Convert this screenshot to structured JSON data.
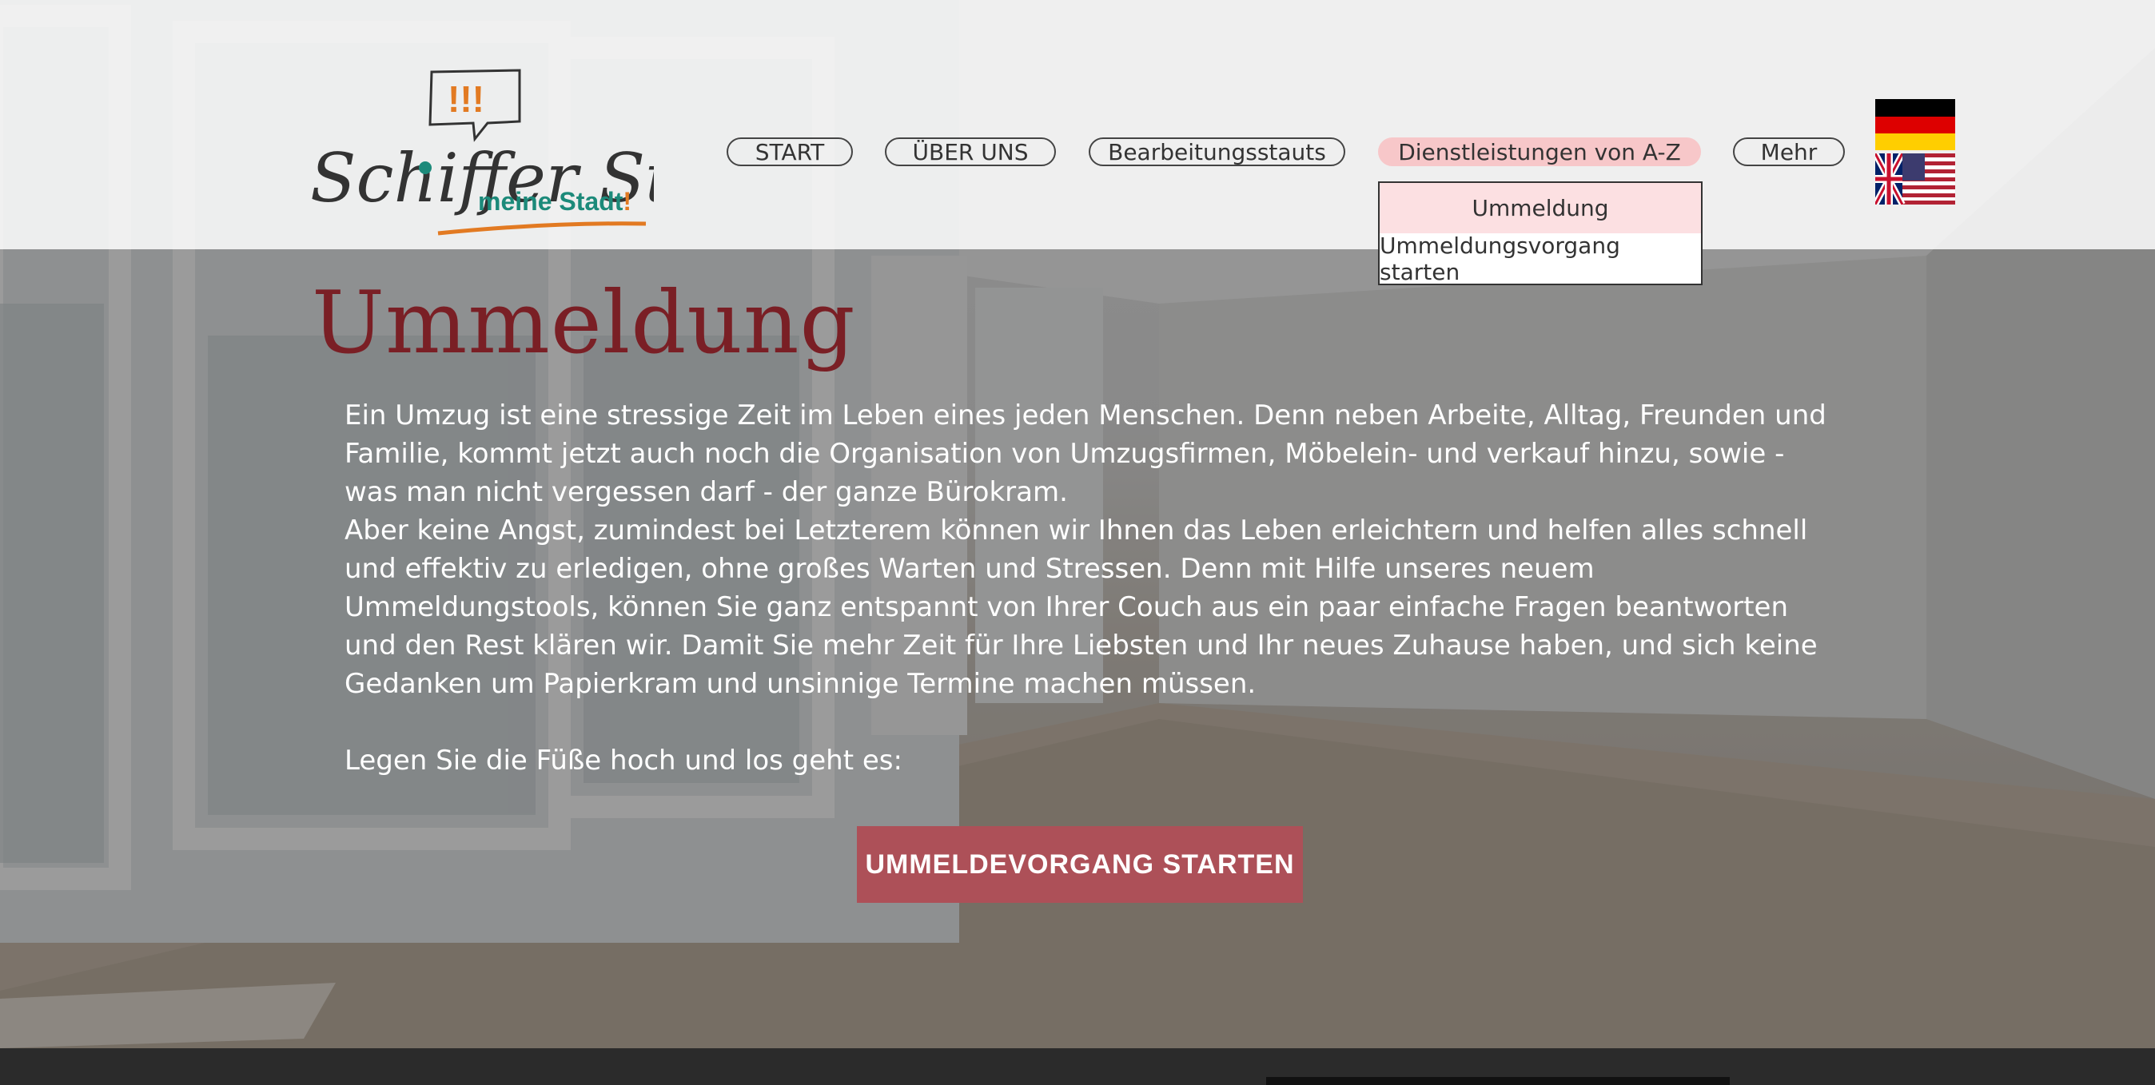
{
  "header": {
    "logo": {
      "script_text": "Schiffer Stadt",
      "exclamations": "!!!",
      "tagline": "meine Stadt",
      "tagline_mark": "!"
    },
    "nav": [
      {
        "label": "START"
      },
      {
        "label": "ÜBER UNS"
      },
      {
        "label": "Bearbeitungsstauts"
      },
      {
        "label": "Dienstleistungen von A-Z",
        "active": true
      },
      {
        "label": "Mehr"
      }
    ],
    "dropdown": [
      {
        "label": "Ummeldung",
        "selected": true
      },
      {
        "label": "Ummeldungsvorgang starten"
      }
    ],
    "languages": [
      {
        "icon": "german-flag-icon"
      },
      {
        "icon": "english-flag-icon"
      }
    ]
  },
  "main": {
    "title": "Ummeldung",
    "paragraph1": "Ein Umzug ist eine stressige Zeit im Leben eines jeden Menschen. Denn neben Arbeite, Alltag, Freunden und Familie, kommt jetzt auch noch die Organisation von Umzugsfirmen, Möbelein- und verkauf hinzu, sowie - was man nicht vergessen darf - der ganze Bürokram.",
    "paragraph2": "Aber keine Angst, zumindest bei Letzterem können wir Ihnen das Leben erleichtern und helfen alles schnell und effektiv zu erledigen, ohne großes Warten und Stressen. Denn mit Hilfe unseres neuem Ummeldungstools, können Sie ganz entspannt von Ihrer Couch aus ein paar einfache Fragen beantworten und den Rest klären wir. Damit Sie mehr Zeit für Ihre Liebsten und Ihr neues Zuhause haben, und sich keine Gedanken um Papierkram und unsinnige Termine machen müssen.",
    "paragraph3": "Legen Sie die Füße hoch und los geht es:",
    "cta_label": "UMMELDEVORGANG STARTEN"
  },
  "colors": {
    "title": "#7a1f25",
    "cta": "#ad5058",
    "nav_active": "#f7c7c9",
    "logo_teal": "#1c8a7a",
    "logo_orange": "#e27a22"
  }
}
